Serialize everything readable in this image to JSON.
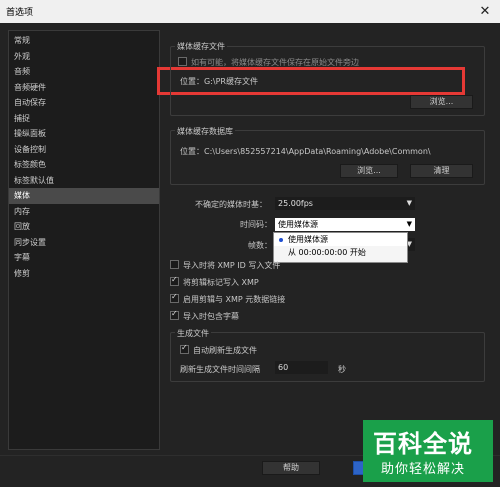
{
  "window": {
    "title": "首选项",
    "close_glyph": "✕"
  },
  "sidebar": {
    "items": [
      {
        "label": "常规"
      },
      {
        "label": "外观"
      },
      {
        "label": "音频"
      },
      {
        "label": "音频硬件"
      },
      {
        "label": "自动保存"
      },
      {
        "label": "捕捉"
      },
      {
        "label": "操纵面板"
      },
      {
        "label": "设备控制"
      },
      {
        "label": "标签颜色"
      },
      {
        "label": "标签默认值"
      },
      {
        "label": "媒体"
      },
      {
        "label": "内存"
      },
      {
        "label": "回放"
      },
      {
        "label": "同步设置"
      },
      {
        "label": "字幕"
      },
      {
        "label": "修剪"
      }
    ],
    "selected": "媒体"
  },
  "media_cache_files": {
    "heading": "媒体缓存文件",
    "save_next_to_original": "如有可能，将媒体缓存文件保存在原始文件旁边",
    "location": "位置：G:\\PR缓存文件",
    "browse_label": "浏览..."
  },
  "media_cache_db": {
    "heading": "媒体缓存数据库",
    "location": "位置：C:\\Users\\852557214\\AppData\\Roaming\\Adobe\\Common\\",
    "browse_label": "浏览...",
    "clean_label": "清理"
  },
  "settings": {
    "timebase_label": "不确定的媒体时基：",
    "timebase_value": "25.00fps",
    "timecode_label": "时间码：",
    "timecode_value": "使用媒体源",
    "timecode_options": [
      "使用媒体源",
      "从 00:00:00:00 开始"
    ],
    "frame_label": "帧数："
  },
  "checkboxes": [
    {
      "label": "导入时将 XMP ID 写入文件",
      "checked": false
    },
    {
      "label": "将剪辑标记写入 XMP",
      "checked": true
    },
    {
      "label": "启用剪辑与 XMP 元数据链接",
      "checked": true
    },
    {
      "label": "导入时包含字幕",
      "checked": true
    }
  ],
  "generate_files": {
    "heading": "生成文件",
    "auto_refresh_label": "自动刷新生成文件",
    "interval_label": "刷新生成文件时间间隔",
    "interval_value": "60",
    "unit": "秒"
  },
  "footer": {
    "help_label": "帮助"
  },
  "watermark": {
    "line1": "百科全说",
    "line2": "助你轻松解决"
  },
  "colors": {
    "annotation_red": "#e53935",
    "popup_bullet": "#1f4fd1",
    "watermark_green": "#1aa04a"
  }
}
